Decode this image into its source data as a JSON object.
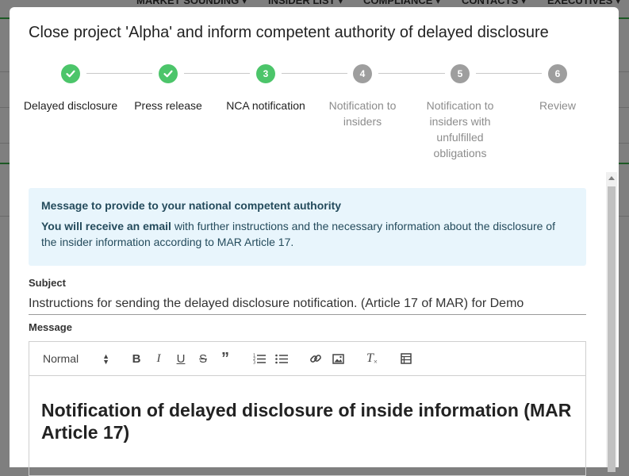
{
  "background": {
    "nav": [
      "MARKET SOUNDING ▾",
      "INSIDER LIST ▾",
      "COMPLIANCE ▾",
      "CONTACTS ▾",
      "EXECUTIVES ▾"
    ]
  },
  "modal": {
    "title": "Close project 'Alpha' and inform competent authority of delayed disclosure"
  },
  "stepper": {
    "steps": [
      {
        "number": "1",
        "label": "Delayed disclosure",
        "state": "done"
      },
      {
        "number": "2",
        "label": "Press release",
        "state": "done"
      },
      {
        "number": "3",
        "label": "NCA notification",
        "state": "active"
      },
      {
        "number": "4",
        "label": "Notification to insiders",
        "state": "pending"
      },
      {
        "number": "5",
        "label": "Notification to insiders with unfulfilled obligations",
        "state": "pending"
      },
      {
        "number": "6",
        "label": "Review",
        "state": "pending"
      }
    ]
  },
  "info": {
    "title": "Message to provide to your national competent authority",
    "bold_lead": "You will receive an email",
    "text": " with further instructions and the necessary information about the disclosure of the insider information according to MAR Article 17."
  },
  "form": {
    "subject_label": "Subject",
    "subject_value": "Instructions for sending the delayed disclosure notification. (Article 17 of MAR) for Demo",
    "message_label": "Message"
  },
  "editor": {
    "format_select": "Normal",
    "content_heading": "Notification of delayed disclosure of inside information (MAR Article 17)"
  },
  "colors": {
    "step_complete": "#4cc56a",
    "step_pending": "#9e9e9e",
    "info_background": "#e8f5fc",
    "info_text": "#244b5c"
  }
}
